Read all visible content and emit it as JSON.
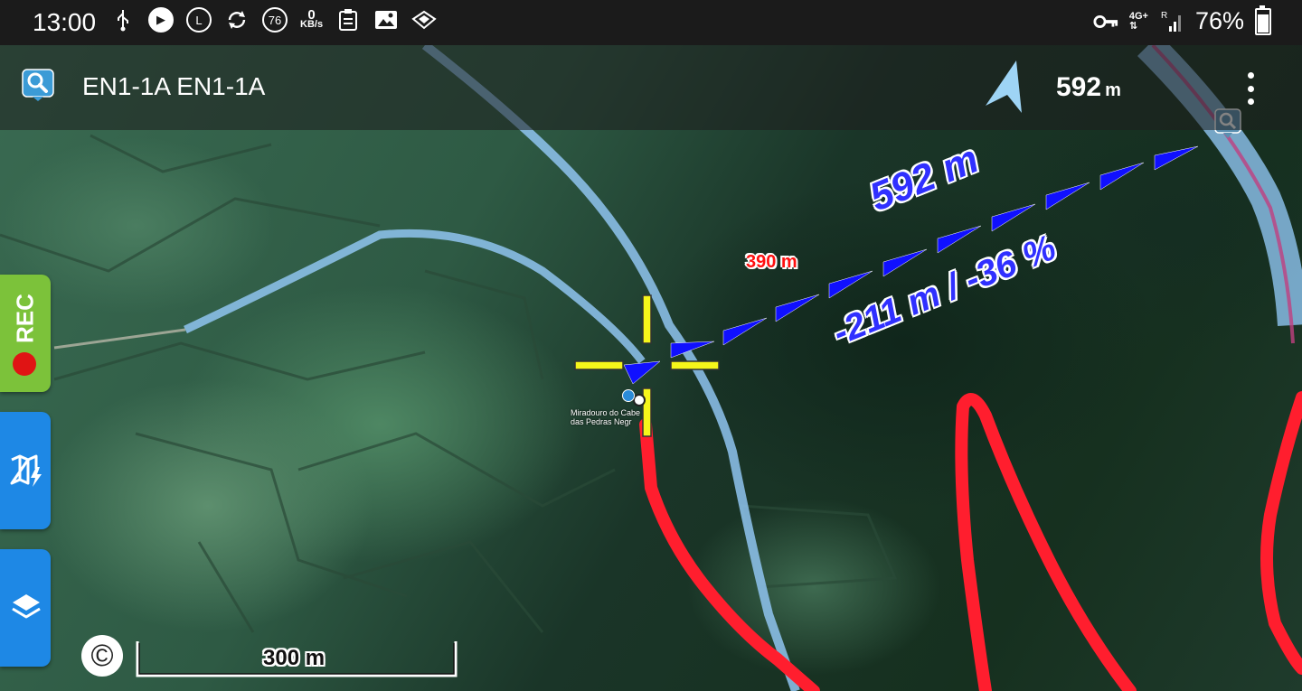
{
  "status_bar": {
    "time": "13:00",
    "net_speed_value": "0",
    "net_speed_unit": "KB/s",
    "badge_76": "76",
    "badge_L": "L",
    "network_type": "4G+",
    "roaming": "R",
    "battery_percent": "76%",
    "battery_level": 0.76
  },
  "app_bar": {
    "title": "EN1-1A EN1-1A",
    "target_distance_value": "592",
    "target_distance_unit": "m"
  },
  "side_buttons": {
    "rec_label": "REC"
  },
  "map": {
    "leg_distance": "592 m",
    "leg_elevation": "-211 m / -36 %",
    "marker_label": "390 m",
    "poi_label_line1": "Miradouro do Cabe",
    "poi_label_line2": "das Pedras Negr",
    "scale_label": "300 m",
    "copyright_symbol": "©",
    "colors": {
      "track_red": "#ff1e2e",
      "route_blue": "#1010ff",
      "crosshair_yellow": "#f6f61a",
      "stream_blue": "#8fc4f0"
    }
  }
}
